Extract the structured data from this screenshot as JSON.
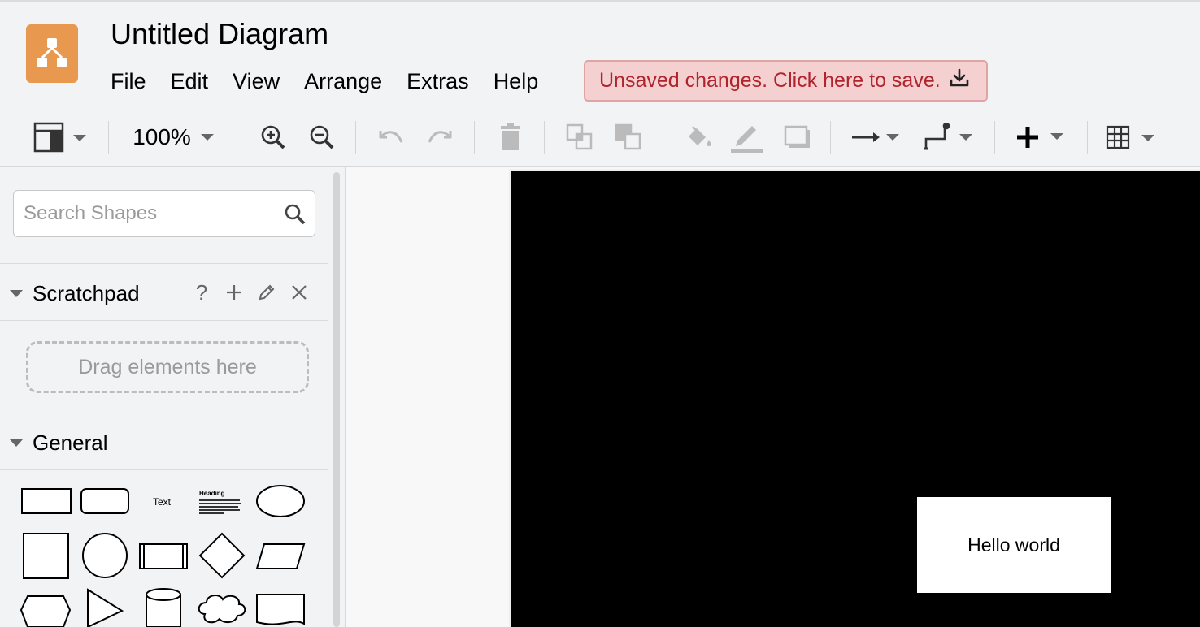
{
  "app": {
    "title": "Untitled Diagram",
    "logo_icon": "drawio-logo-icon",
    "brand_color": "#e9984f"
  },
  "menu": [
    "File",
    "Edit",
    "View",
    "Arrange",
    "Extras",
    "Help"
  ],
  "save_banner": {
    "text": "Unsaved changes. Click here to save.",
    "icon": "download-icon",
    "text_color": "#b0242d",
    "bg_color": "#f4d0d0"
  },
  "toolbar": {
    "zoom": "100%",
    "items": [
      "format-panel-icon",
      "zoom-in-icon",
      "zoom-out-icon",
      "undo-icon",
      "redo-icon",
      "delete-icon",
      "to-front-icon",
      "to-back-icon",
      "fill-color-icon",
      "line-color-icon",
      "shadow-icon",
      "connection-icon",
      "waypoints-icon",
      "insert-icon",
      "table-icon"
    ]
  },
  "sidebar": {
    "search": {
      "placeholder": "Search Shapes",
      "value": ""
    },
    "scratchpad": {
      "label": "Scratchpad",
      "help": "?",
      "dropzone": "Drag elements here"
    },
    "general": {
      "label": "General",
      "shapes": [
        "rectangle",
        "rounded-rectangle",
        "text",
        "textbox",
        "ellipse",
        "square",
        "circle",
        "process",
        "diamond",
        "parallelogram",
        "hexagon",
        "triangle",
        "cylinder",
        "cloud",
        "document"
      ],
      "text_sample": "Text",
      "heading_sample": "Heading"
    }
  },
  "canvas": {
    "page_color": "#000000",
    "cell_text": "Hello world"
  }
}
